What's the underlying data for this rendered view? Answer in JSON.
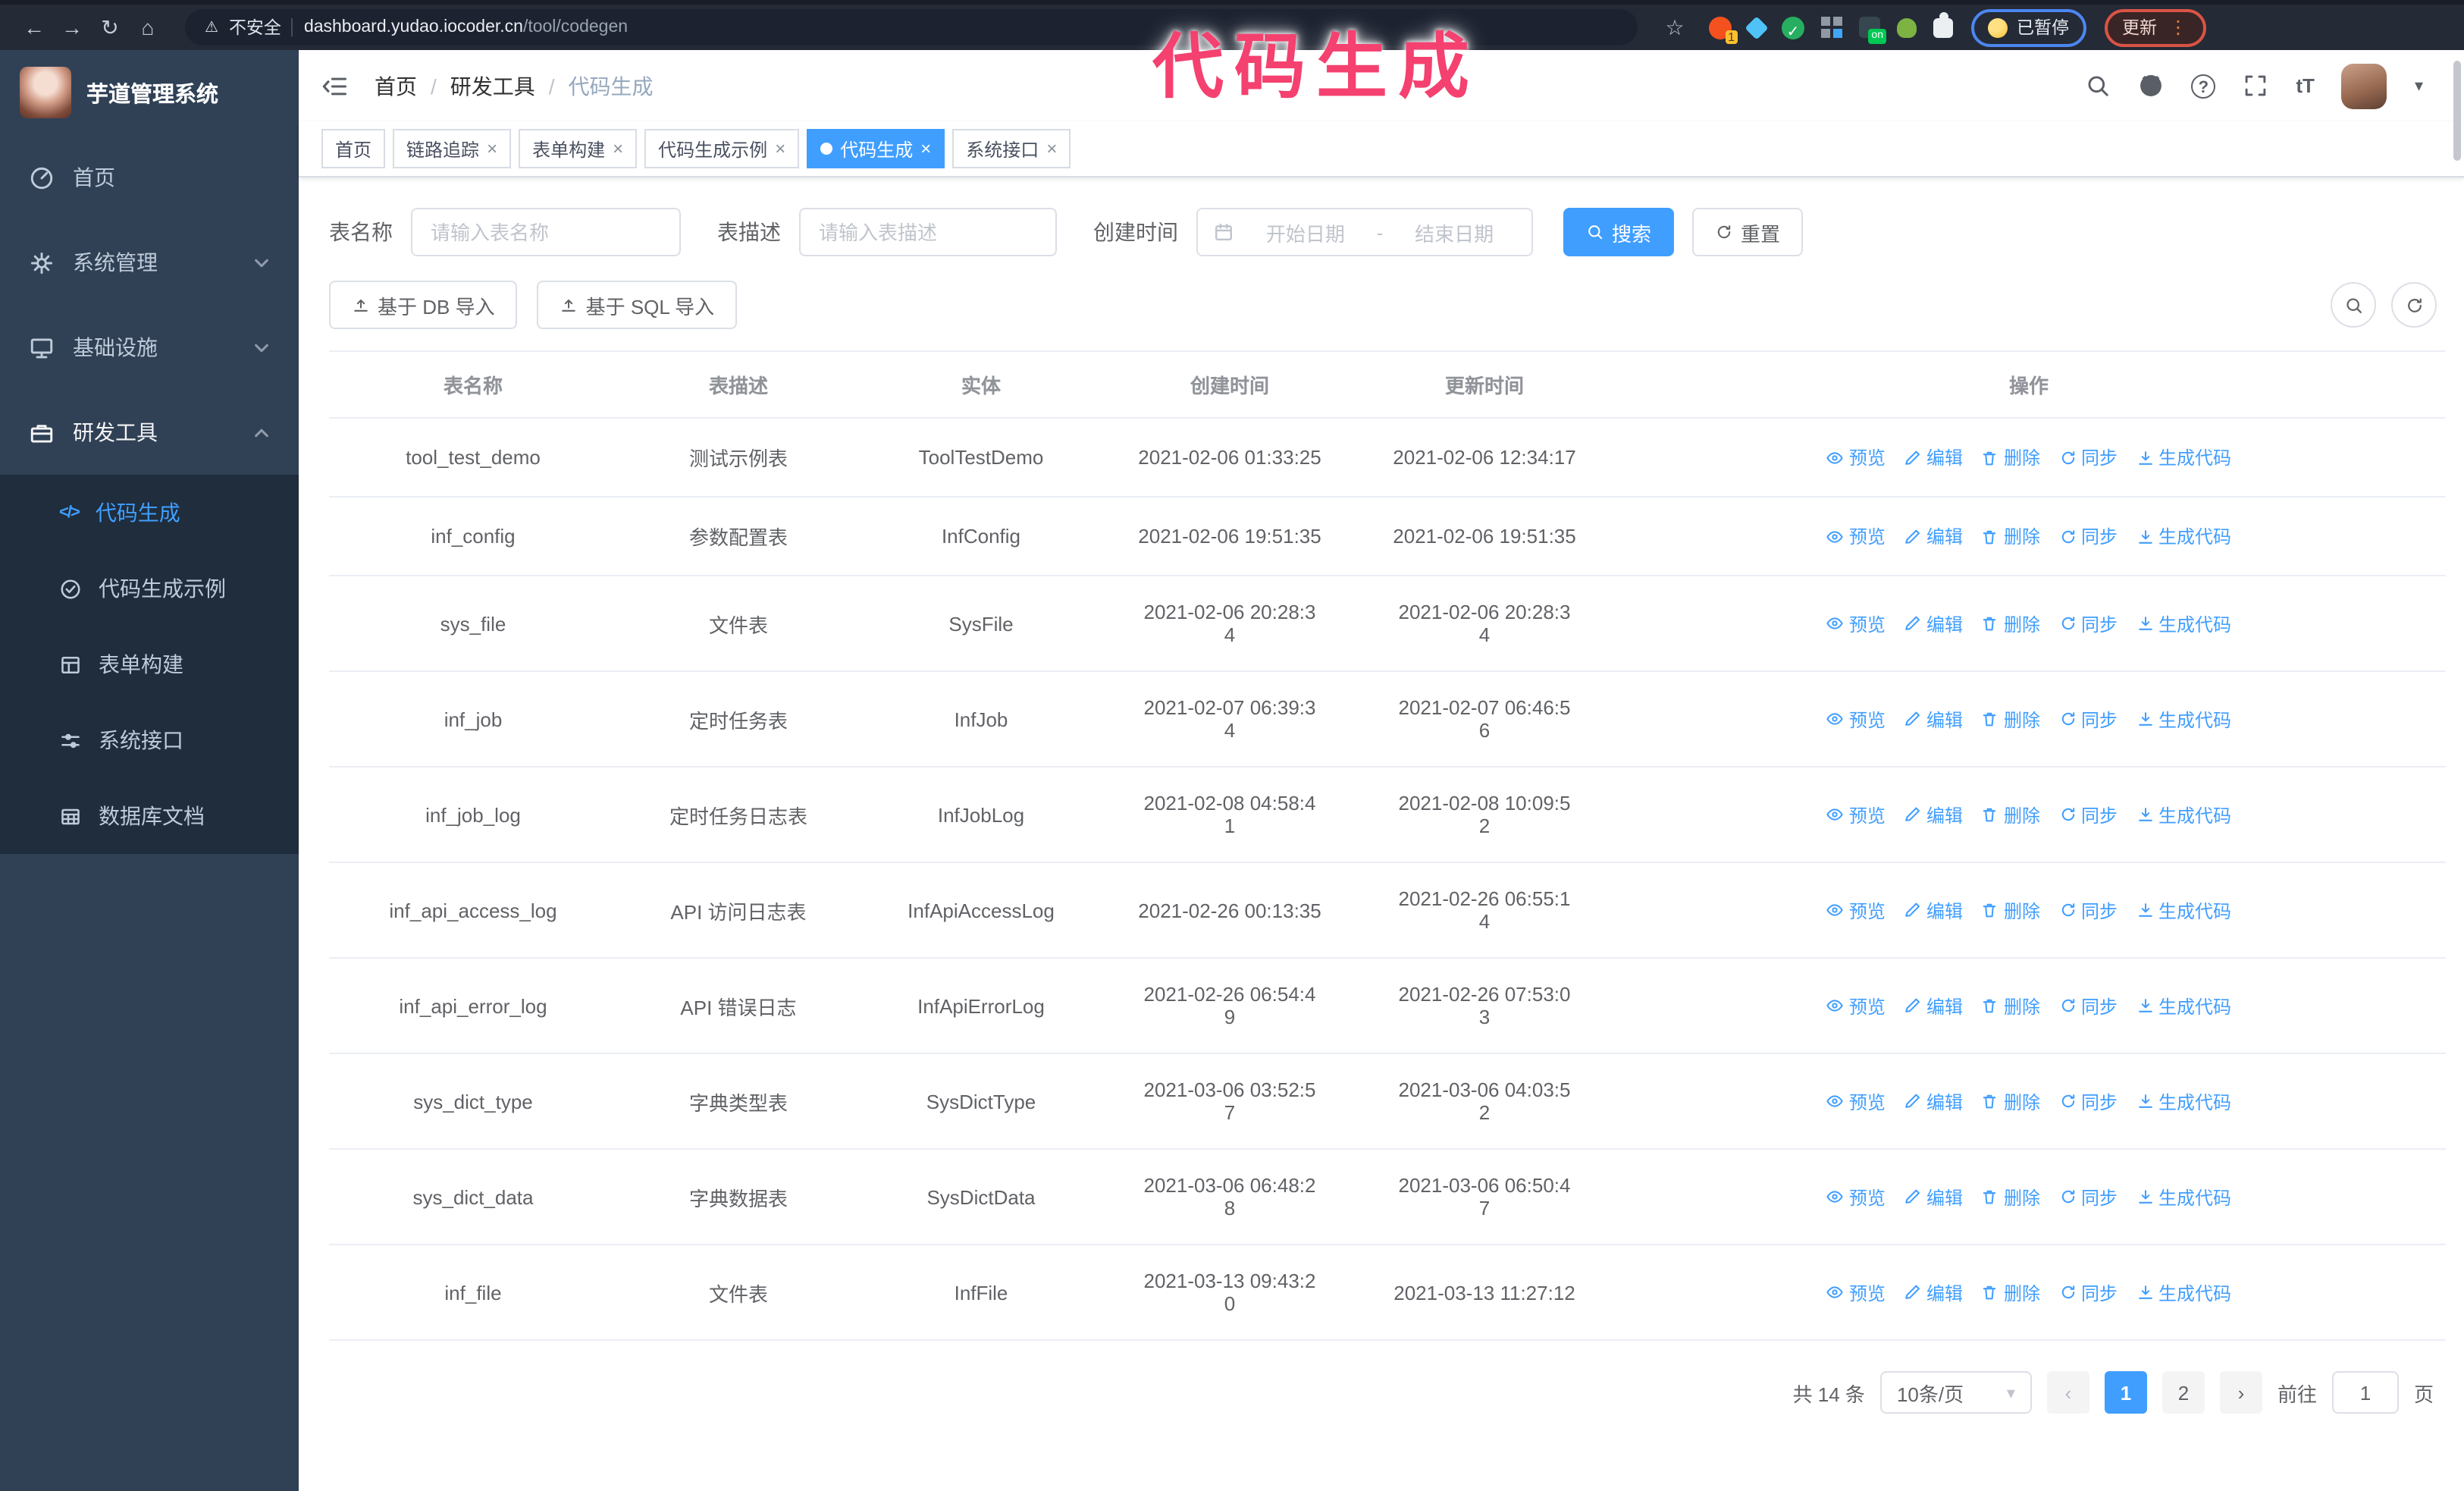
{
  "browser": {
    "security_label": "不安全",
    "url_host": "dashboard.yudao.iocoder.cn",
    "url_path": "/tool/codegen",
    "extension_badge": "1",
    "extension_on_badge": "on",
    "paused_badge": "已暂停",
    "update_button": "更新"
  },
  "annotation": {
    "text": "代码生成",
    "color": "#f4416f"
  },
  "sidebar": {
    "app_title": "芋道管理系统",
    "items": [
      {
        "label": "首页"
      },
      {
        "label": "系统管理"
      },
      {
        "label": "基础设施"
      },
      {
        "label": "研发工具"
      }
    ],
    "submenu": [
      {
        "label": "代码生成"
      },
      {
        "label": "代码生成示例"
      },
      {
        "label": "表单构建"
      },
      {
        "label": "系统接口"
      },
      {
        "label": "数据库文档"
      }
    ]
  },
  "header": {
    "breadcrumb": [
      "首页",
      "研发工具",
      "代码生成"
    ]
  },
  "tabs": [
    {
      "label": "首页"
    },
    {
      "label": "链路追踪"
    },
    {
      "label": "表单构建"
    },
    {
      "label": "代码生成示例"
    },
    {
      "label": "代码生成"
    },
    {
      "label": "系统接口"
    }
  ],
  "filters": {
    "table_name_label": "表名称",
    "table_name_placeholder": "请输入表名称",
    "table_desc_label": "表描述",
    "table_desc_placeholder": "请输入表描述",
    "create_time_label": "创建时间",
    "date_start_placeholder": "开始日期",
    "date_separator": "-",
    "date_end_placeholder": "结束日期",
    "search_button": "搜索",
    "reset_button": "重置"
  },
  "toolbar": {
    "import_db_button": "基于 DB 导入",
    "import_sql_button": "基于 SQL 导入"
  },
  "table": {
    "columns": [
      "表名称",
      "表描述",
      "实体",
      "创建时间",
      "更新时间",
      "操作"
    ],
    "actions": [
      "预览",
      "编辑",
      "删除",
      "同步",
      "生成代码"
    ],
    "rows": [
      {
        "name": "tool_test_demo",
        "desc": "测试示例表",
        "entity": "ToolTestDemo",
        "created": "2021-02-06 01:33:25",
        "updated": "2021-02-06 12:34:17"
      },
      {
        "name": "inf_config",
        "desc": "参数配置表",
        "entity": "InfConfig",
        "created": "2021-02-06 19:51:35",
        "updated": "2021-02-06 19:51:35"
      },
      {
        "name": "sys_file",
        "desc": "文件表",
        "entity": "SysFile",
        "created": "2021-02-06 20:28:3\n4",
        "updated": "2021-02-06 20:28:3\n4"
      },
      {
        "name": "inf_job",
        "desc": "定时任务表",
        "entity": "InfJob",
        "created": "2021-02-07 06:39:3\n4",
        "updated": "2021-02-07 06:46:5\n6"
      },
      {
        "name": "inf_job_log",
        "desc": "定时任务日志表",
        "entity": "InfJobLog",
        "created": "2021-02-08 04:58:4\n1",
        "updated": "2021-02-08 10:09:5\n2"
      },
      {
        "name": "inf_api_access_log",
        "desc": "API 访问日志表",
        "entity": "InfApiAccessLog",
        "created": "2021-02-26 00:13:35",
        "updated": "2021-02-26 06:55:1\n4"
      },
      {
        "name": "inf_api_error_log",
        "desc": "API 错误日志",
        "entity": "InfApiErrorLog",
        "created": "2021-02-26 06:54:4\n9",
        "updated": "2021-02-26 07:53:0\n3"
      },
      {
        "name": "sys_dict_type",
        "desc": "字典类型表",
        "entity": "SysDictType",
        "created": "2021-03-06 03:52:5\n7",
        "updated": "2021-03-06 04:03:5\n2"
      },
      {
        "name": "sys_dict_data",
        "desc": "字典数据表",
        "entity": "SysDictData",
        "created": "2021-03-06 06:48:2\n8",
        "updated": "2021-03-06 06:50:4\n7"
      },
      {
        "name": "inf_file",
        "desc": "文件表",
        "entity": "InfFile",
        "created": "2021-03-13 09:43:2\n0",
        "updated": "2021-03-13 11:27:12"
      }
    ]
  },
  "pagination": {
    "total_label": "共 14 条",
    "page_size": "10条/页",
    "pages": [
      "1",
      "2"
    ],
    "goto_label": "前往",
    "goto_value": "1",
    "page_suffix_label": "页"
  },
  "icons": {
    "back": "←",
    "forward": "→",
    "reload": "↻",
    "home": "⌂",
    "star": "☆",
    "warning": "⚠",
    "check": "✓",
    "kebab": "⋮",
    "close": "×",
    "caret_down": "▾",
    "breadcrumb_separator": "/",
    "chevron_left": "‹",
    "chevron_right": "›",
    "code": "</>",
    "font_size": "tT",
    "question": "?"
  }
}
